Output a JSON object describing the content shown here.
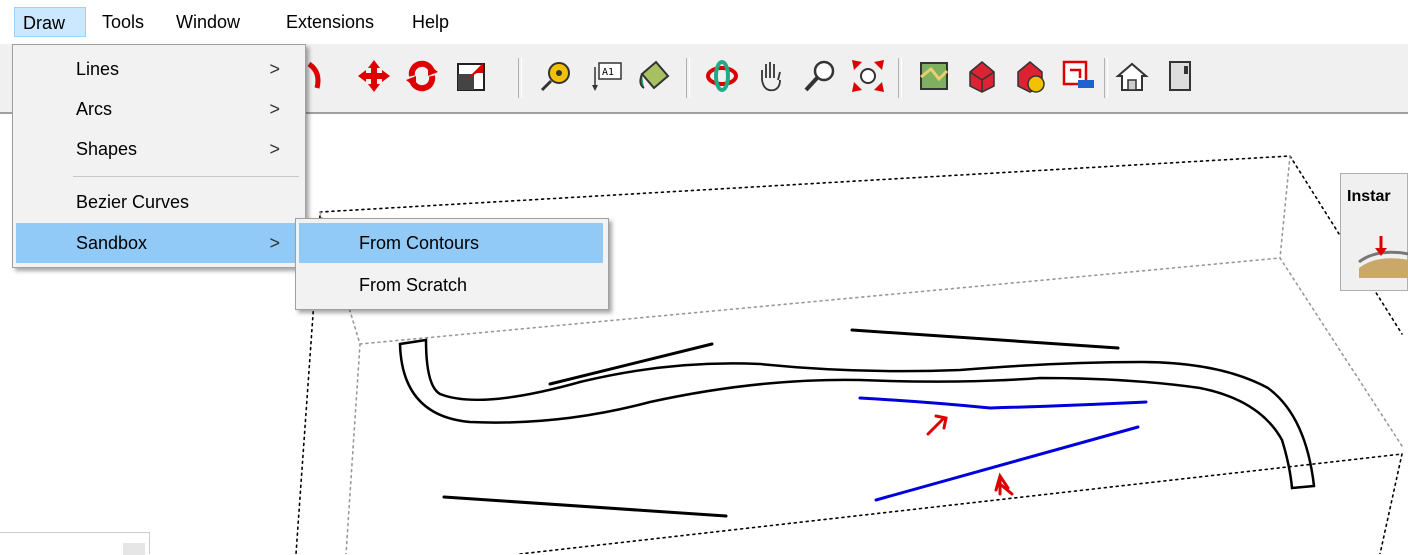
{
  "menubar": {
    "items": [
      {
        "label": "Draw",
        "active": true
      },
      {
        "label": "Tools"
      },
      {
        "label": "Window"
      },
      {
        "label": "Extensions"
      },
      {
        "label": "Help"
      }
    ]
  },
  "draw_menu": {
    "items": [
      {
        "label": "Lines",
        "submenu_arrow": ">"
      },
      {
        "label": "Arcs",
        "submenu_arrow": ">"
      },
      {
        "label": "Shapes",
        "submenu_arrow": ">"
      },
      {
        "label": "Bezier Curves"
      },
      {
        "label": "Sandbox",
        "submenu_arrow": ">",
        "highlighted": true
      }
    ]
  },
  "sandbox_menu": {
    "items": [
      {
        "label": "From Contours",
        "highlighted": true
      },
      {
        "label": "From Scratch"
      }
    ]
  },
  "toolbar": {
    "icons": [
      "eraser-icon",
      "paint-icon",
      "move-icon",
      "rotate-icon",
      "scale-icon",
      "tape-measure-icon",
      "text-icon",
      "paint-bucket-icon",
      "orbit-icon",
      "pan-icon",
      "zoom-icon",
      "zoom-extents-icon",
      "map-icon",
      "warehouse-icon",
      "extension-warehouse-icon",
      "send-to-layout-icon",
      "home-icon",
      "door-icon"
    ]
  },
  "instant_panel": {
    "title": "Instar"
  },
  "colors": {
    "menu_highlight": "#91c9f7",
    "menubar_active": "#cce8ff",
    "contour_blue": "#0000dd",
    "arrow_red": "#dd0000"
  }
}
